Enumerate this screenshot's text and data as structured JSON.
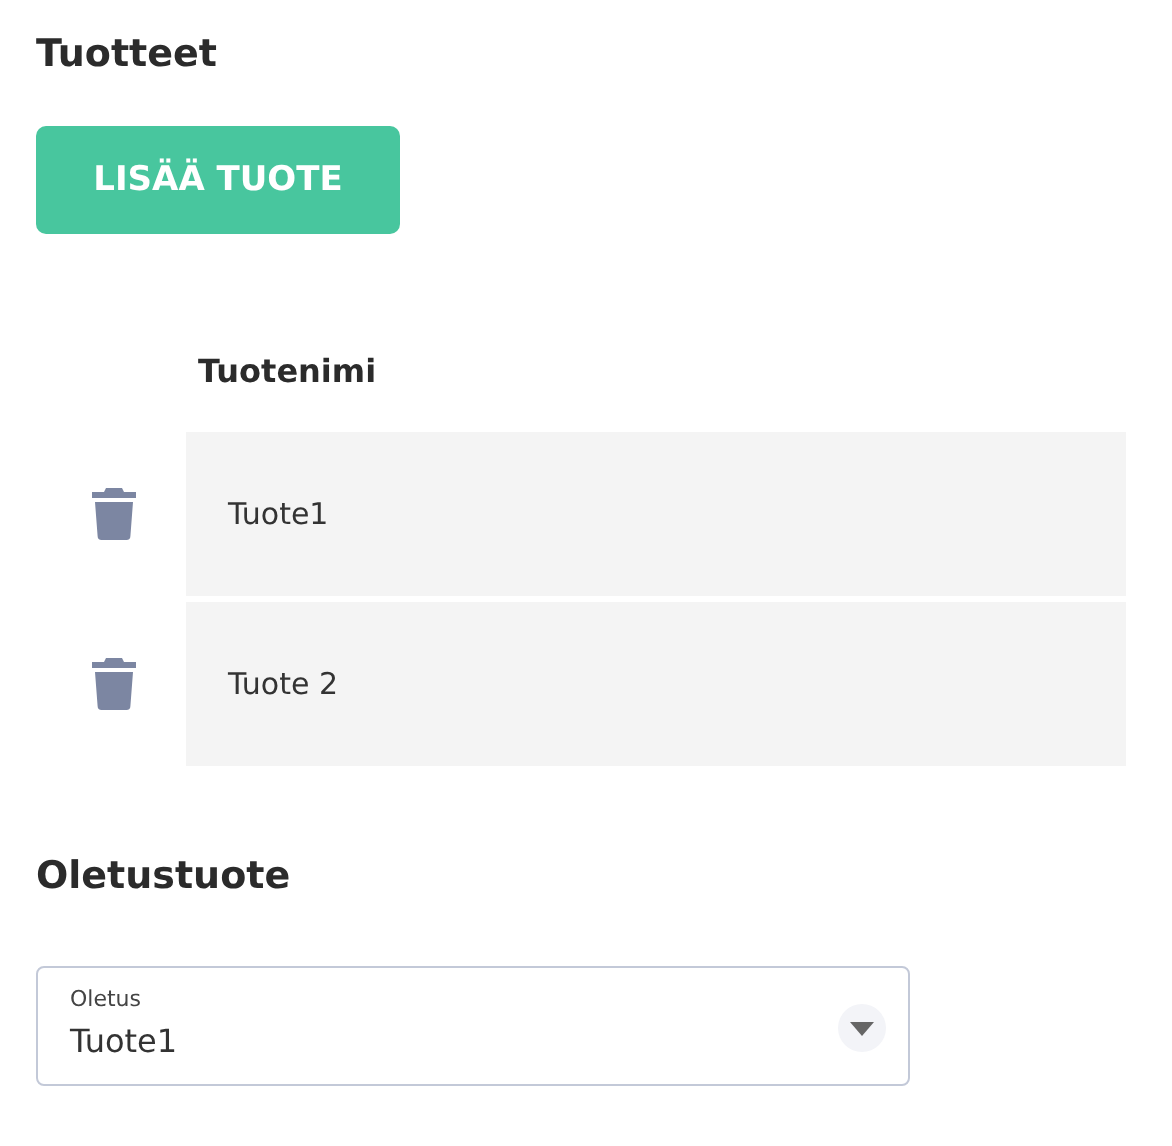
{
  "products_section": {
    "title": "Tuotteet",
    "add_button": "LISÄÄ TUOTE"
  },
  "table": {
    "columns": [
      "Tuotenimi"
    ],
    "rows": [
      {
        "name": "Tuote1"
      },
      {
        "name": "Tuote 2"
      }
    ]
  },
  "default_section": {
    "title": "Oletustuote",
    "select": {
      "label": "Oletus",
      "value": "Tuote1"
    }
  }
}
